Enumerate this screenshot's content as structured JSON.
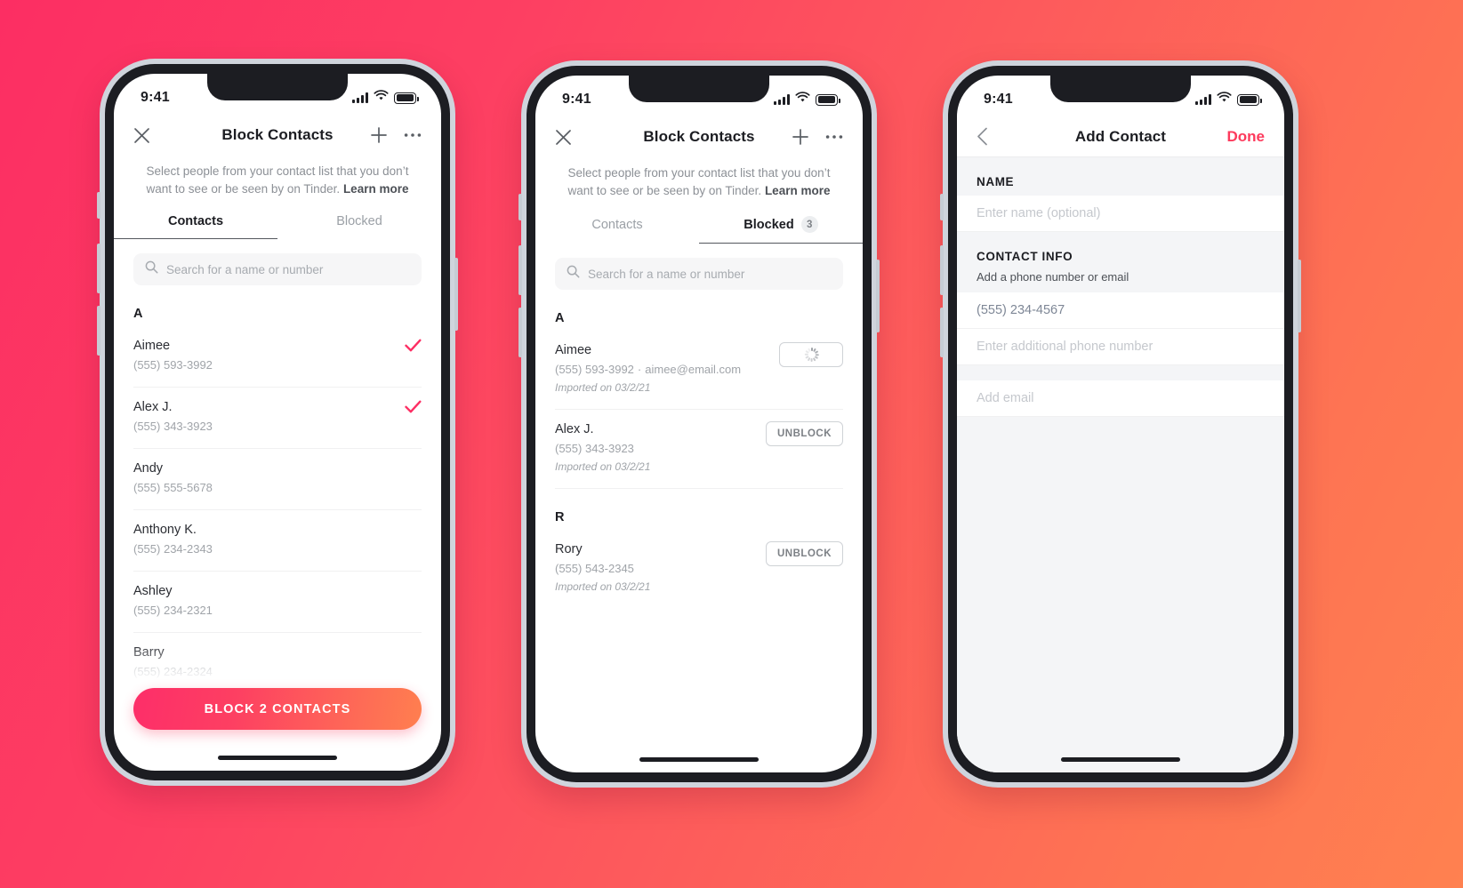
{
  "background": {
    "from": "#FC2E63",
    "to": "#FF8150"
  },
  "accent": "#FD3A5C",
  "phones": [
    {
      "status": {
        "time": "9:41",
        "signal_icon": "cellular-bars-icon",
        "wifi_icon": "wifi-icon",
        "battery_icon": "battery-full-icon"
      },
      "nav": {
        "close_icon": "close-icon",
        "title": "Block Contacts",
        "add_icon": "plus-icon",
        "more_icon": "more-horizontal-icon"
      },
      "subtitle": {
        "text": "Select people from your contact list that you don’t want to see or be seen by on Tinder. ",
        "link": "Learn more"
      },
      "tabs": [
        {
          "label": "Contacts",
          "active": true,
          "badge": ""
        },
        {
          "label": "Blocked",
          "active": false,
          "badge": ""
        }
      ],
      "search": {
        "icon": "search-icon",
        "placeholder": "Search for a name or number",
        "value": ""
      },
      "sections": [
        {
          "letter": "A",
          "rows": [
            {
              "name": "Aimee",
              "sub": "(555) 593-3992",
              "selected": true
            },
            {
              "name": "Alex J.",
              "sub": "(555) 343-3923",
              "selected": true
            },
            {
              "name": "Andy",
              "sub": "(555) 555-5678",
              "selected": false
            },
            {
              "name": "Anthony K.",
              "sub": "(555) 234-2343",
              "selected": false
            },
            {
              "name": "Ashley",
              "sub": "(555) 234-2321",
              "selected": false
            },
            {
              "name": "Barry",
              "sub": "(555) 234-2324",
              "selected": false
            }
          ]
        }
      ],
      "cta": {
        "label": "BLOCK 2 CONTACTS"
      }
    },
    {
      "status": {
        "time": "9:41",
        "signal_icon": "cellular-bars-icon",
        "wifi_icon": "wifi-icon",
        "battery_icon": "battery-full-icon"
      },
      "nav": {
        "close_icon": "close-icon",
        "title": "Block Contacts",
        "add_icon": "plus-icon",
        "more_icon": "more-horizontal-icon"
      },
      "subtitle": {
        "text": "Select people from your contact list that you don’t want to see or be seen by on Tinder. ",
        "link": "Learn more"
      },
      "tabs": [
        {
          "label": "Contacts",
          "active": false,
          "badge": ""
        },
        {
          "label": "Blocked",
          "active": true,
          "badge": "3"
        }
      ],
      "search": {
        "icon": "search-icon",
        "placeholder": "Search for a name or number",
        "value": ""
      },
      "blocked_sections": [
        {
          "letter": "A",
          "rows": [
            {
              "name": "Aimee",
              "phone": "(555) 593-3992",
              "separator": "·",
              "email": "aimee@email.com",
              "meta": "Imported on 03/2/21",
              "action": "",
              "loading": true
            },
            {
              "name": "Alex J.",
              "phone": "(555) 343-3923",
              "separator": "",
              "email": "",
              "meta": "Imported on 03/2/21",
              "action": "UNBLOCK",
              "loading": false
            }
          ]
        },
        {
          "letter": "R",
          "rows": [
            {
              "name": "Rory",
              "phone": "(555) 543-2345",
              "separator": "",
              "email": "",
              "meta": "Imported on 03/2/21",
              "action": "UNBLOCK",
              "loading": false
            }
          ]
        }
      ]
    },
    {
      "status": {
        "time": "9:41",
        "signal_icon": "cellular-bars-icon",
        "wifi_icon": "wifi-icon",
        "battery_icon": "battery-full-icon"
      },
      "nav": {
        "back_icon": "chevron-left-icon",
        "title": "Add Contact",
        "done_label": "Done"
      },
      "groups": [
        {
          "head": "NAME",
          "sub": "",
          "fields": [
            {
              "placeholder": "Enter name (optional)",
              "value": ""
            }
          ]
        },
        {
          "head": "CONTACT INFO",
          "sub": "Add a phone number or email",
          "fields": [
            {
              "placeholder": "",
              "value": "(555) 234-4567"
            },
            {
              "placeholder": "Enter additional phone number",
              "value": ""
            }
          ]
        },
        {
          "head": "",
          "sub": "",
          "fields": [
            {
              "placeholder": "Add email",
              "value": ""
            }
          ]
        }
      ]
    }
  ]
}
